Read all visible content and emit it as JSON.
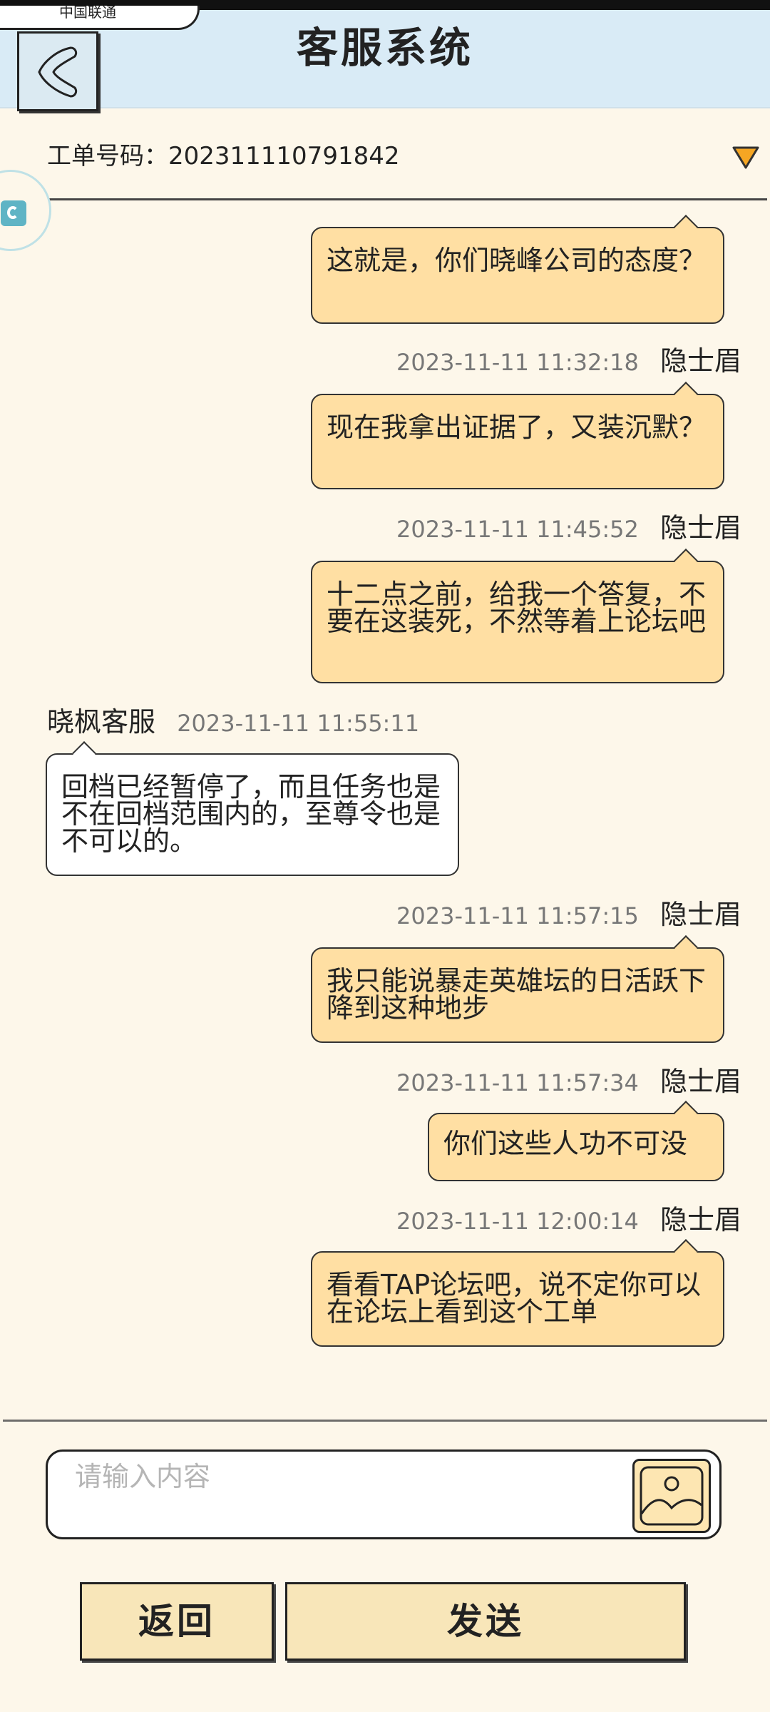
{
  "header": {
    "title": "客服系统",
    "tab_fragment": "中国联通"
  },
  "ticket": {
    "label": "工单号码：",
    "number": "202311110791842"
  },
  "messages": [
    {
      "role": "user",
      "time": "",
      "sender": "",
      "text": "这就是，你们晓峰公司的态度？"
    },
    {
      "role": "user",
      "time": "2023-11-11 11:32:18",
      "sender": "隐士眉",
      "text": "现在我拿出证据了，又装沉默？"
    },
    {
      "role": "user",
      "time": "2023-11-11 11:45:52",
      "sender": "隐士眉",
      "text": "十二点之前，给我一个答复，不要在这装死，不然等着上论坛吧"
    },
    {
      "role": "agent",
      "time": "2023-11-11 11:55:11",
      "sender": "晓枫客服",
      "text": "回档已经暂停了，而且任务也是不在回档范围内的，至尊令也是不可以的。"
    },
    {
      "role": "user",
      "time": "2023-11-11 11:57:15",
      "sender": "隐士眉",
      "text": "我只能说暴走英雄坛的日活跃下降到这种地步"
    },
    {
      "role": "user",
      "time": "2023-11-11 11:57:34",
      "sender": "隐士眉",
      "text": "你们这些人功不可没"
    },
    {
      "role": "user",
      "time": "2023-11-11 12:00:14",
      "sender": "隐士眉",
      "text": "看看TAP论坛吧，说不定你可以在论坛上看到这个工单"
    }
  ],
  "composer": {
    "placeholder": "请输入内容",
    "value": ""
  },
  "buttons": {
    "back": "返回",
    "send": "发送"
  },
  "colors": {
    "header_bg": "#d9ebf6",
    "page_bg": "#fdf7ea",
    "user_bubble": "#ffdfa3",
    "agent_bubble": "#ffffff",
    "button_bg": "#f8e6b9",
    "dropdown": "#f5a623"
  },
  "icons": {
    "back": "back-arrow-icon",
    "dropdown": "triangle-down-icon",
    "image": "image-upload-icon"
  }
}
